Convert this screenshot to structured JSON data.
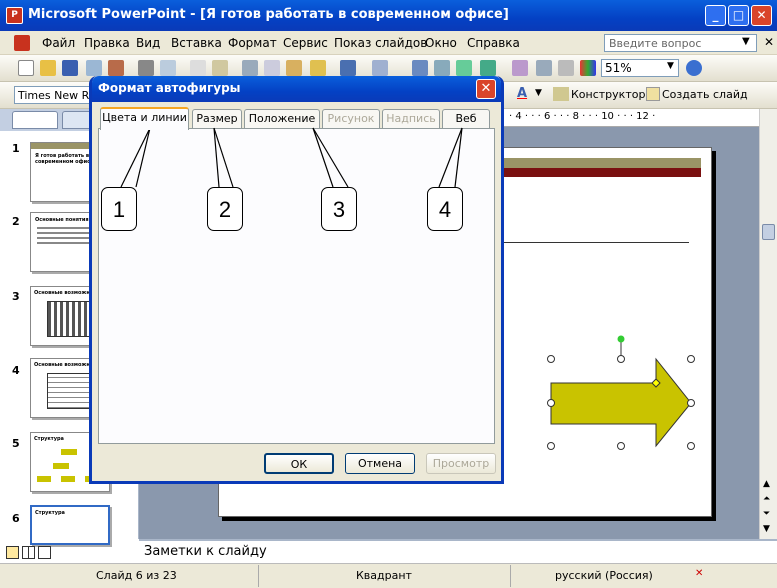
{
  "window": {
    "title": "Microsoft PowerPoint - [Я готов работать в современном офисе]",
    "app_icon": "P"
  },
  "menu": [
    "Файл",
    "Правка",
    "Вид",
    "Вставка",
    "Формат",
    "Сервис",
    "Показ слайдов",
    "Окно",
    "Справка"
  ],
  "help_placeholder": "Введите вопрос",
  "toolbar": {
    "zoom": "51%",
    "font": "Times New Roman",
    "designer": "Конструктор",
    "new_slide": "Создать слайд"
  },
  "ruler_text": "· 4 · · · 6 · · · 8 · · · 10 · · · 12 ·",
  "slides": [
    {
      "num": "1",
      "title": "Я готов работать в современном офисе"
    },
    {
      "num": "2",
      "title": "Основные понятия"
    },
    {
      "num": "3",
      "title": "Основные возможности"
    },
    {
      "num": "4",
      "title": "Основные возможности"
    },
    {
      "num": "5",
      "title": "Структура"
    },
    {
      "num": "6",
      "title": "Структура"
    }
  ],
  "dialog": {
    "title": "Формат автофигуры",
    "tabs": [
      {
        "label": "Цвета и линии",
        "state": "active"
      },
      {
        "label": "Размер",
        "state": "normal"
      },
      {
        "label": "Положение",
        "state": "normal"
      },
      {
        "label": "Рисунок",
        "state": "disabled"
      },
      {
        "label": "Надпись",
        "state": "disabled"
      },
      {
        "label": "Веб",
        "state": "normal"
      }
    ],
    "ok": "ОК",
    "cancel": "Отмена",
    "preview": "Просмотр"
  },
  "callouts": [
    "1",
    "2",
    "3",
    "4"
  ],
  "notes_placeholder": "Заметки к слайду",
  "status": {
    "slide": "Слайд 6 из 23",
    "design": "Квадрант",
    "language": "русский (Россия)"
  },
  "colors": {
    "title_blue": "#0441c4",
    "arrow_fill": "#c9c300",
    "slide_bar_olive": "#9a9466",
    "slide_bar_dark": "#7a1010",
    "tab_highlight": "#f5a623"
  }
}
